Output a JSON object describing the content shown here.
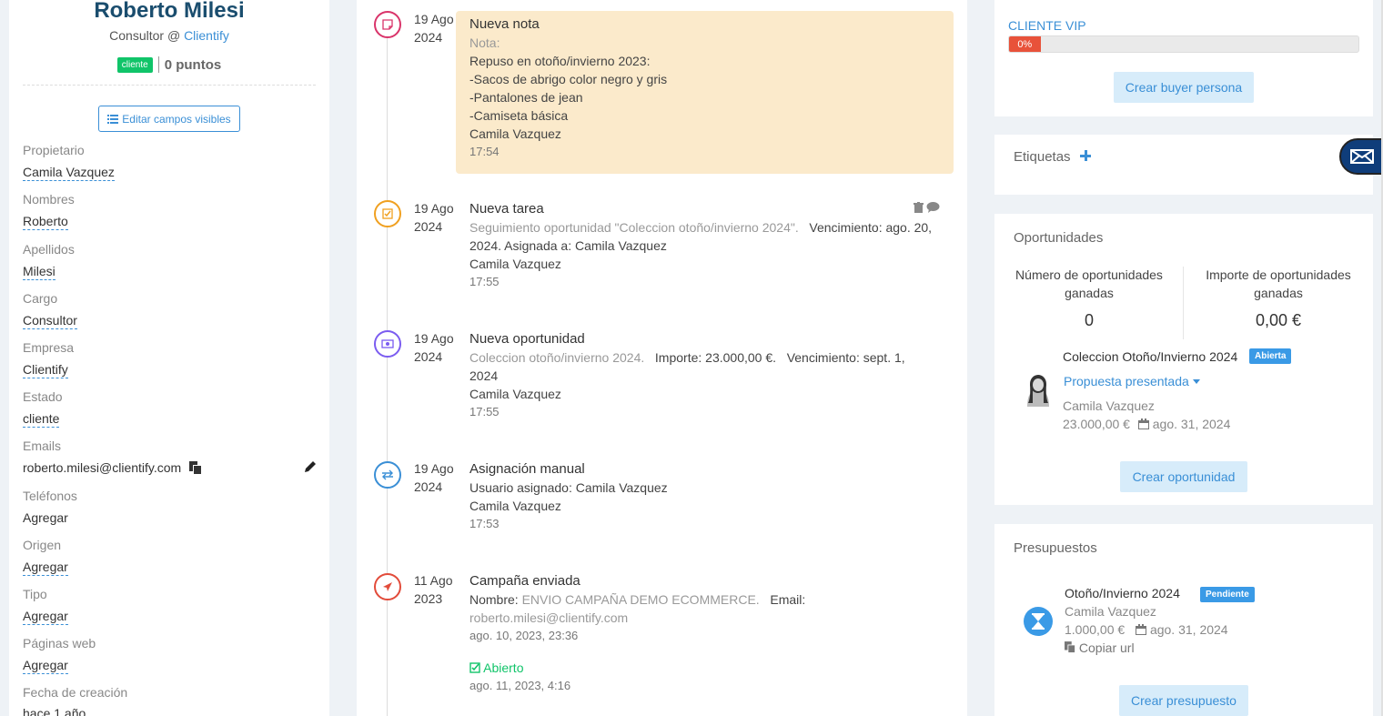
{
  "contact": {
    "name": "Roberto Milesi",
    "role_prefix": "Consultor @ ",
    "company": "Clientify",
    "status_badge": "cliente",
    "points": "0 puntos",
    "edit_fields_label": "Editar campos visibles"
  },
  "fields": [
    {
      "label": "Propietario",
      "value": "Camila Vazquez"
    },
    {
      "label": "Nombres",
      "value": "Roberto"
    },
    {
      "label": "Apellidos",
      "value": "Milesi"
    },
    {
      "label": "Cargo",
      "value": "Consultor"
    },
    {
      "label": "Empresa",
      "value": "Clientify"
    },
    {
      "label": "Estado",
      "value": "cliente"
    },
    {
      "label": "Emails",
      "value": "roberto.milesi@clientify.com"
    },
    {
      "label": "Teléfonos",
      "value": "Agregar"
    },
    {
      "label": "Origen",
      "value": "Agregar"
    },
    {
      "label": "Tipo",
      "value": "Agregar"
    },
    {
      "label": "Páginas web",
      "value": "Agregar"
    },
    {
      "label": "Fecha de creación",
      "value": "hace 1 año"
    }
  ],
  "timeline": {
    "note": {
      "date_day": "19 Ago",
      "date_year": "2024",
      "title": "Nueva nota",
      "label": "Nota:",
      "lines": [
        "Repuso en otoño/invierno 2023:",
        "-Sacos de abrigo color negro y gris",
        "-Pantalones de jean",
        "-Camiseta básica"
      ],
      "author": "Camila Vazquez",
      "time": "17:54"
    },
    "task": {
      "date_day": "19 Ago",
      "date_year": "2024",
      "title": "Nueva tarea",
      "desc": "Seguimiento oportunidad \"Coleccion otoño/invierno 2024\".",
      "due": "Vencimiento: ago. 20,",
      "line2": "2024.   Asignada a: Camila Vazquez",
      "author": "Camila Vazquez",
      "time": "17:55"
    },
    "opportunity": {
      "date_day": "19 Ago",
      "date_year": "2024",
      "title": "Nueva oportunidad",
      "name": "Coleccion otoño/invierno 2024.",
      "amount": "Importe: 23.000,00 €.",
      "due": "Vencimiento: sept. 1,",
      "line2": "2024",
      "author": "Camila Vazquez",
      "time": "17:55"
    },
    "assign": {
      "date_day": "19 Ago",
      "date_year": "2024",
      "title": "Asignación manual",
      "line1": "Usuario asignado: Camila Vazquez",
      "author": "Camila Vazquez",
      "time": "17:53"
    },
    "campaign": {
      "date_day": "11 Ago",
      "date_year": "2023",
      "title": "Campaña enviada",
      "name_label": "Nombre:",
      "name": "ENVIO CAMPAÑA DEMO ECOMMERCE.",
      "email_label": "Email:",
      "email": "roberto.milesi@clientify.com",
      "sent": "ago. 10, 2023, 23:36",
      "opened": "Abierto",
      "opened_time": "ago. 11, 2023, 4:16"
    }
  },
  "buyer": {
    "vip_label": "CLIENTE VIP",
    "progress_text": "0%",
    "progress_fraction": 0.09,
    "button": "Crear buyer persona"
  },
  "tags": {
    "title": "Etiquetas"
  },
  "opportunities": {
    "title": "Oportunidades",
    "won_count_label_1": "Número de oportunidades",
    "won_count_label_2": "ganadas",
    "won_count": "0",
    "won_amount_label_1": "Importe de oportunidades",
    "won_amount_label_2": "ganadas",
    "won_amount": "0,00 €",
    "item": {
      "name": "Coleccion Otoño/Invierno 2024",
      "badge": "Abierta",
      "stage": "Propuesta presentada",
      "owner": "Camila Vazquez",
      "amount": "23.000,00 €",
      "date": "ago. 31, 2024"
    },
    "button": "Crear oportunidad"
  },
  "budgets": {
    "title": "Presupuestos",
    "item": {
      "name": "Otoño/Invierno 2024",
      "badge": "Pendiente",
      "owner": "Camila Vazquez",
      "amount": "1.000,00 €",
      "date": "ago. 31, 2024",
      "copy_url": "Copiar url"
    },
    "button": "Crear presupuesto"
  },
  "colors": {
    "accent": "#3a8fd6",
    "note_bg": "#fbeacb",
    "success": "#10c469",
    "danger": "#e8523a"
  }
}
